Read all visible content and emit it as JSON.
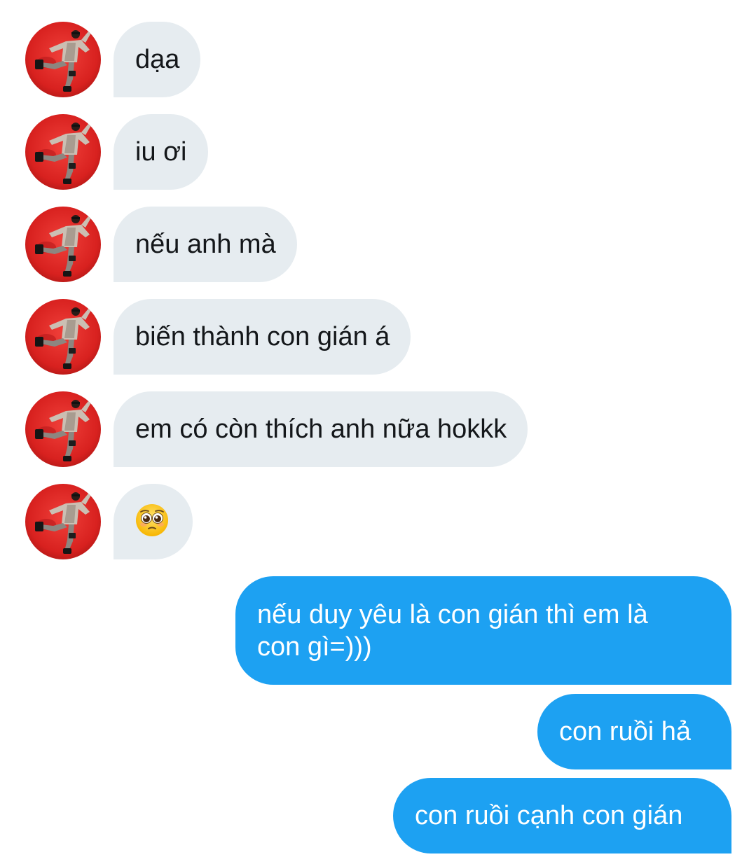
{
  "conversation": {
    "incoming": [
      {
        "text": "dạa"
      },
      {
        "text": "iu ơi"
      },
      {
        "text": "nếu anh mà"
      },
      {
        "text": "biến thành con gián á"
      },
      {
        "text": "em có còn thích anh nữa hokkk"
      },
      {
        "emoji": "pleading-face-emoji"
      }
    ],
    "outgoing": [
      {
        "line1": "nếu duy yêu là con gián thì em là",
        "line2": "con gì=)))"
      },
      {
        "text": "con ruồi hả"
      },
      {
        "text": "con ruồi cạnh con gián"
      }
    ]
  },
  "colors": {
    "incoming_bubble": "#e6ecf0",
    "outgoing_bubble": "#1da1f2",
    "avatar_background": "#d8211f"
  },
  "icons": {
    "avatar": "dancer-photo-avatar"
  }
}
